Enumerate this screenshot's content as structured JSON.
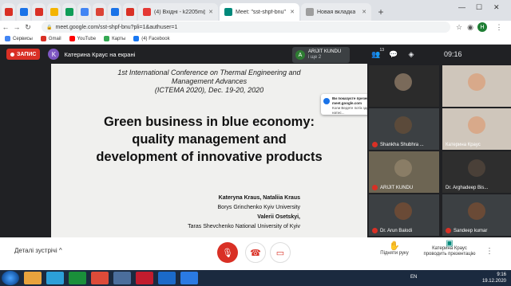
{
  "browser": {
    "tabs": [
      {
        "label": "",
        "fav_color": "#d93025"
      },
      {
        "label": "",
        "fav_color": "#1a73e8"
      },
      {
        "label": "",
        "fav_color": "#d93025"
      },
      {
        "label": "",
        "fav_color": "#f4b400"
      },
      {
        "label": "",
        "fav_color": "#0f9d58"
      },
      {
        "label": "",
        "fav_color": "#4285f4"
      },
      {
        "label": "",
        "fav_color": "#db4437"
      },
      {
        "label": "",
        "fav_color": "#1a73e8"
      },
      {
        "label": "",
        "fav_color": "#d93025"
      },
      {
        "label": "(4) Вхідні - k2205m@ukr.net",
        "fav_color": "#e53935"
      },
      {
        "label": "Meet: \"sst-shpf-bnu\"",
        "fav_color": "#00897b"
      },
      {
        "label": "Новая вкладка",
        "fav_color": "#9e9e9e"
      }
    ],
    "new_tab": "+",
    "url": "meet.google.com/sst-shpf-bnu?pli=1&authuser=1",
    "profile_initial": "H",
    "bookmarks": [
      "Сервисы",
      "Gmail",
      "YouTube",
      "Карты",
      "(4) Facebook"
    ]
  },
  "meet": {
    "recording_label": "ЗАПИС",
    "presenter_initial": "K",
    "presenting_text": "Катерина Краус на екрані",
    "pinned": {
      "initial": "A",
      "name": "ARIJIT KUNDU",
      "sub": "і ще 2"
    },
    "participants_count": "13",
    "time": "09:16",
    "notification": {
      "title": "Ви показуєте презентацію для всіх на meet.google.com",
      "body": "Коли Ведете потік здорових презентації, натис..."
    },
    "slide": {
      "conference_line1": "1st International Conference on Thermal Engineering and",
      "conference_line2": "Management Advances",
      "conference_line3": "(ICTEMA 2020), Dec. 19-20, 2020",
      "title_line1": "Green business in blue economy:",
      "title_line2": "quality management and",
      "title_line3": "development of innovative products",
      "authors": "Kateryna Kraus, Nataliia Kraus",
      "affil1": "Borys Grinchenko Kyiv University",
      "author2": "Valerii Osetskyi,",
      "affil2": "Taras Shevchenko National University of Kyiv"
    },
    "tiles": [
      {
        "name": "",
        "face_color": "#7a6a5a",
        "bg": "#2b2b2b",
        "muted": false
      },
      {
        "name": "",
        "face_color": "#d8a98a",
        "bg": "#cfc6bb",
        "muted": false
      },
      {
        "name": "Shankha Shubhra ...",
        "face_color": "#5b4a3a",
        "bg": "#3c4043",
        "muted": true
      },
      {
        "name": "Катерина Краус",
        "face_color": "#d8a98a",
        "bg": "#cfc6bb",
        "muted": false
      },
      {
        "name": "ARIJIT KUNDU",
        "face_color": "#8a7d66",
        "bg": "#6d6553",
        "muted": true
      },
      {
        "name": "Dr. Arghadeep Bis...",
        "face_color": "#4a4038",
        "bg": "#2e2e2e",
        "muted": false
      },
      {
        "name": "Dr. Arun Balodi",
        "face_color": "#6a4a36",
        "bg": "#3c4043",
        "muted": true
      },
      {
        "name": "Sandeep kumar",
        "face_color": "#6a4a36",
        "bg": "#3c4043",
        "muted": true
      }
    ],
    "details_label": "Деталі зустрічі",
    "raise_hand_label": "Підняти руку",
    "presenting_label_line1": "Катерина Краус",
    "presenting_label_line2": "проводить презентацію"
  },
  "taskbar": {
    "lang": "EN",
    "time": "9:16",
    "date": "19.12.2020",
    "apps": [
      "#e8a33d",
      "#2c9fd8",
      "#1a8f3a",
      "#dd4b39",
      "#4b6e9c",
      "#c21c2e",
      "#1b6ac9",
      "#2a7ae2"
    ]
  }
}
